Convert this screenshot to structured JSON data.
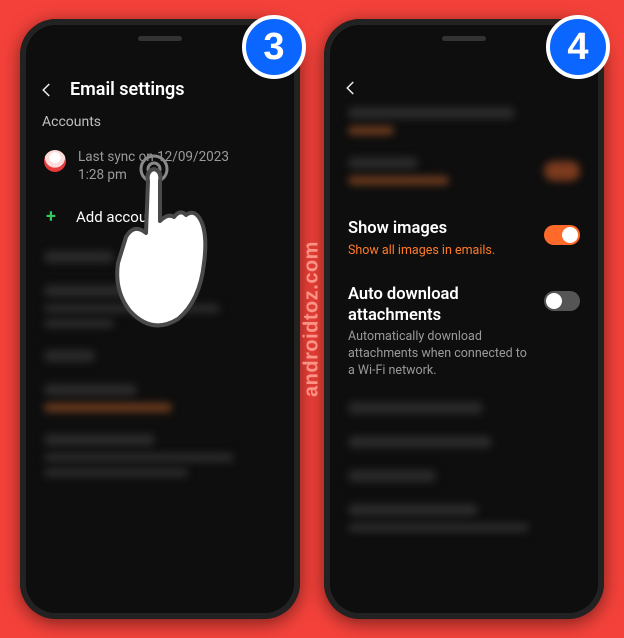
{
  "watermark": "androidtoz.com",
  "steps": {
    "left": "3",
    "right": "4"
  },
  "left": {
    "header_title": "Email settings",
    "section": "Accounts",
    "account": {
      "last_sync_line1": "Last sync     on 12/09/2023",
      "last_sync_line2": "1:28 pm"
    },
    "add_account": "Add account"
  },
  "right": {
    "show_images": {
      "title": "Show images",
      "sub": "Show all images in emails.",
      "on": true
    },
    "auto_dl": {
      "title": "Auto download attachments",
      "sub": "Automatically download attachments when connected to a Wi-Fi network.",
      "on": false
    }
  }
}
